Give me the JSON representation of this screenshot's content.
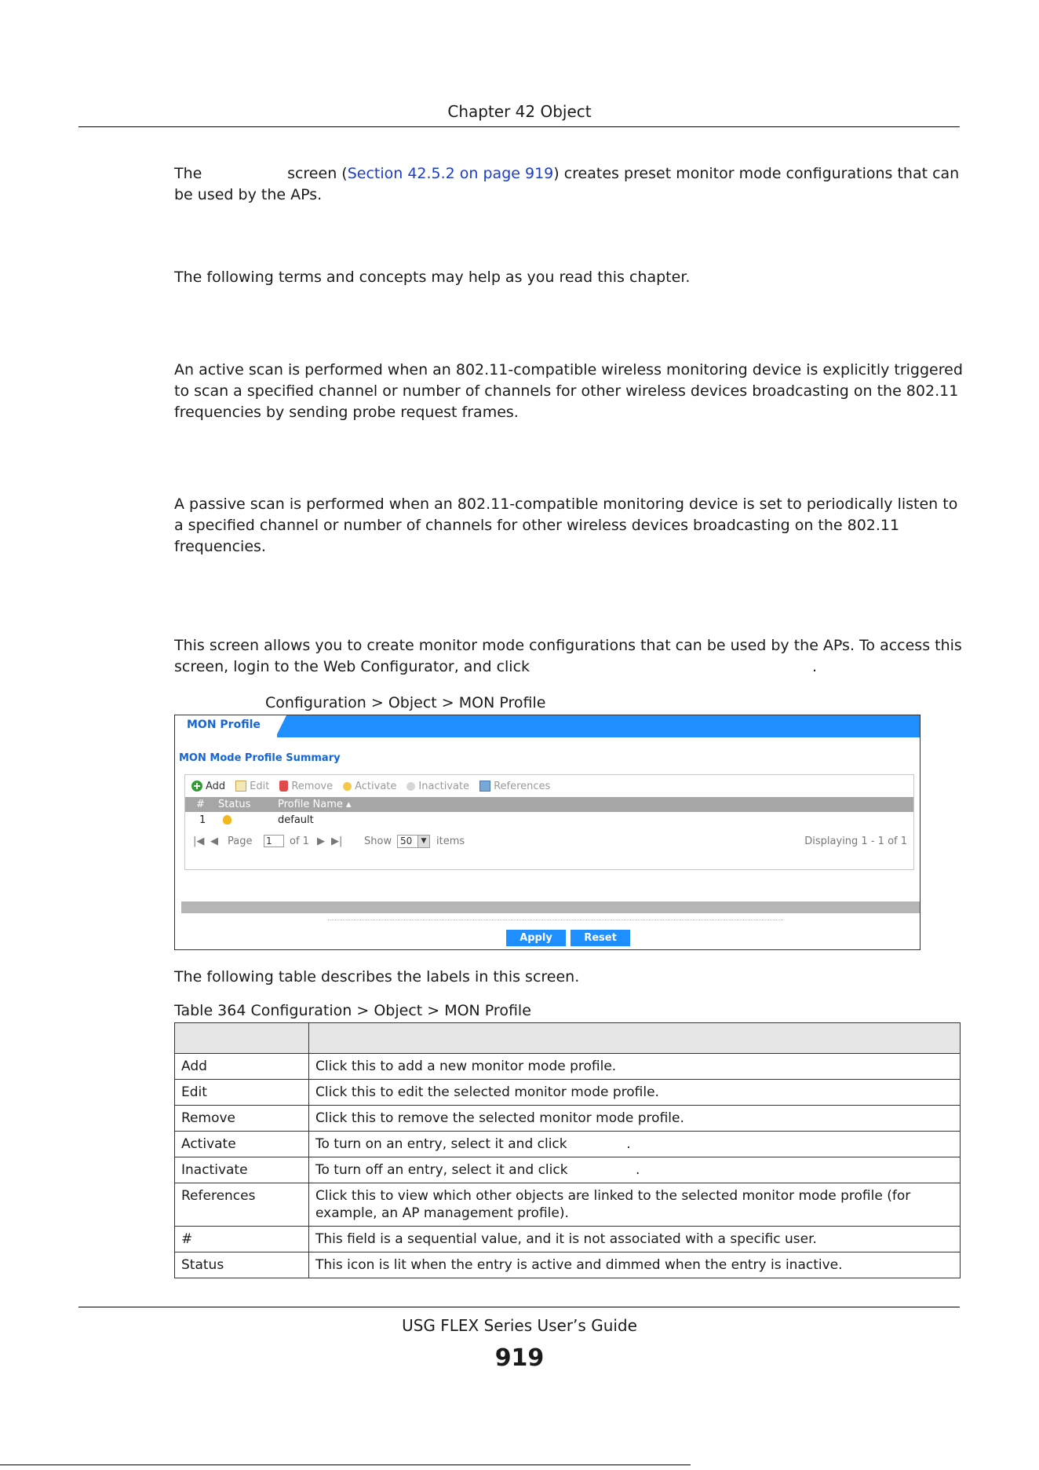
{
  "header": {
    "chapter": "Chapter 42 Object"
  },
  "intro": {
    "p1_before": "The ",
    "p1_gap": "                ",
    "p1_mid": " screen (",
    "p1_link": "Section 42.5.2 on page 919",
    "p1_after": ") creates preset monitor mode configurations that can be used by the APs.",
    "p2": "The following terms and concepts may help as you read this chapter.",
    "p3": "An active scan is performed when an 802.11-compatible wireless monitoring device is explicitly triggered to scan a specified channel or number of channels for other wireless devices broadcasting on the 802.11 frequencies by sending probe request frames.",
    "p4": "A passive scan is performed when an 802.11-compatible monitoring device is set to periodically listen to a specified channel or number of channels for other wireless devices broadcasting on the 802.11 frequencies.",
    "p5": "This screen allows you to create monitor mode configurations that can be used by the APs. To access this screen, login to the Web Configurator, and click",
    "p5_end": "."
  },
  "figure": {
    "caption": "Configuration > Object > MON Profile"
  },
  "ui": {
    "tab": "MON Profile",
    "summary_title": "MON Mode Profile Summary",
    "toolbar": {
      "add": "Add",
      "edit": "Edit",
      "remove": "Remove",
      "activate": "Activate",
      "inactivate": "Inactivate",
      "references": "References"
    },
    "columns": {
      "num": "#",
      "status": "Status",
      "profile_name": "Profile Name ▴"
    },
    "rows": [
      {
        "num": "1",
        "status": "active",
        "profile_name": "default"
      }
    ],
    "pager": {
      "page_label": "Page",
      "page_value": "1",
      "of_label": "of 1",
      "show_label": "Show",
      "show_value": "50",
      "items_label": "items",
      "displaying": "Displaying 1 - 1 of 1"
    },
    "apply": "Apply",
    "reset": "Reset"
  },
  "after_figure": "The following table describes the labels in this screen.",
  "table": {
    "caption": "Table 364   Configuration > Object > MON Profile",
    "header": [
      "",
      ""
    ],
    "rows": [
      [
        "Add",
        "Click this to add a new monitor mode profile."
      ],
      [
        "Edit",
        "Click this to edit the selected monitor mode profile."
      ],
      [
        "Remove",
        "Click this to remove the selected monitor mode profile."
      ],
      [
        "Activate",
        "To turn on an entry, select it and click              ."
      ],
      [
        "Inactivate",
        "To turn off an entry, select it and click                ."
      ],
      [
        "References",
        "Click this to view which other objects are linked to the selected monitor mode profile (for example, an AP management profile)."
      ],
      [
        "#",
        "This field is a sequential value, and it is not associated with a specific user."
      ],
      [
        "Status",
        "This icon is lit when the entry is active and dimmed when the entry is inactive."
      ]
    ]
  },
  "footer": {
    "guide": "USG FLEX Series User’s Guide",
    "page": "919"
  }
}
